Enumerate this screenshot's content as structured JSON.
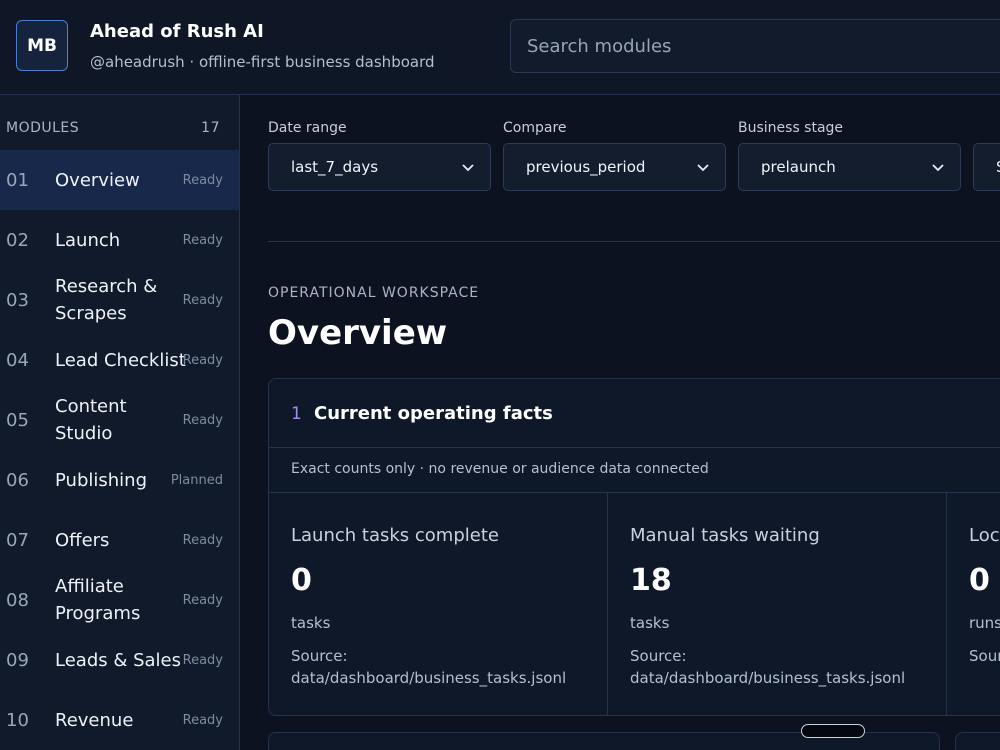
{
  "brand": {
    "initials": "MB",
    "title": "Ahead of Rush AI",
    "subtitle": "@aheadrush · offline-first business dashboard"
  },
  "search": {
    "placeholder": "Search modules"
  },
  "sidebar": {
    "heading": "MODULES",
    "count": "17",
    "items": [
      {
        "num": "01",
        "label": "Overview",
        "status": "Ready",
        "active": true
      },
      {
        "num": "02",
        "label": "Launch",
        "status": "Ready"
      },
      {
        "num": "03",
        "label": "Research & Scrapes",
        "status": "Ready"
      },
      {
        "num": "04",
        "label": "Lead Checklist",
        "status": "Ready"
      },
      {
        "num": "05",
        "label": "Content Studio",
        "status": "Ready"
      },
      {
        "num": "06",
        "label": "Publishing",
        "status": "Planned"
      },
      {
        "num": "07",
        "label": "Offers",
        "status": "Ready"
      },
      {
        "num": "08",
        "label": "Affiliate Programs",
        "status": "Ready"
      },
      {
        "num": "09",
        "label": "Leads & Sales",
        "status": "Ready"
      },
      {
        "num": "10",
        "label": "Revenue",
        "status": "Ready"
      }
    ]
  },
  "filters": {
    "date_range": {
      "label": "Date range",
      "value": "last_7_days"
    },
    "compare": {
      "label": "Compare",
      "value": "previous_period"
    },
    "stage": {
      "label": "Business stage",
      "value": "prelaunch"
    },
    "fourth": {
      "value": "S"
    }
  },
  "main": {
    "eyebrow": "OPERATIONAL WORKSPACE",
    "title": "Overview",
    "card": {
      "num": "1",
      "title": "Current operating facts",
      "note": "Exact counts only · no revenue or audience data connected",
      "metrics": [
        {
          "label": "Launch tasks complete",
          "value": "0",
          "unit": "tasks",
          "source_label": "Source:",
          "source": "data/dashboard/business_tasks.jsonl"
        },
        {
          "label": "Manual tasks waiting",
          "value": "18",
          "unit": "tasks",
          "source_label": "Source:",
          "source": "data/dashboard/business_tasks.jsonl"
        },
        {
          "label": "Loca",
          "value": "0",
          "unit": "runs",
          "source_label": "Sour",
          "source": ""
        }
      ]
    }
  },
  "colors": {
    "background": "#0c1220",
    "active_item": "#17284a",
    "accent_number": "#a48cf0",
    "avatar_border": "#4d7fd0"
  }
}
